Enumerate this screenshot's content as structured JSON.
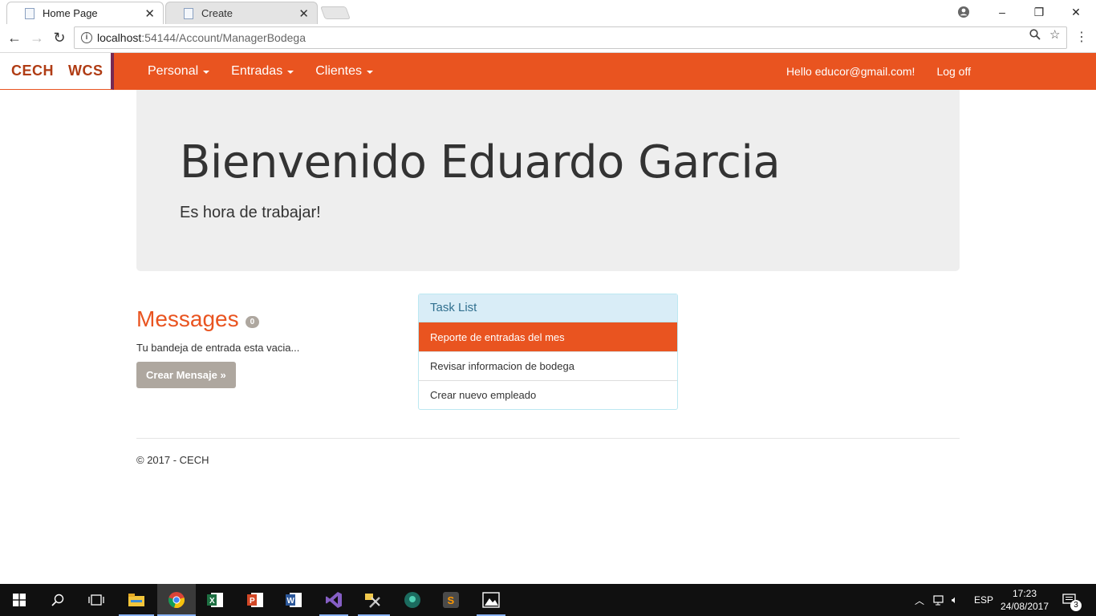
{
  "browser": {
    "tabs": [
      {
        "label": "Home Page",
        "active": true
      },
      {
        "label": "Create",
        "active": false
      }
    ],
    "url_host": "localhost",
    "url_path": ":54144/Account/ManagerBodega",
    "window_controls": {
      "minimize": "–",
      "maximize": "❐",
      "close": "✕"
    }
  },
  "navbar": {
    "brand_left": "CECH",
    "brand_right": "WCS",
    "menu": [
      {
        "label": "Personal"
      },
      {
        "label": "Entradas"
      },
      {
        "label": "Clientes"
      }
    ],
    "greeting": "Hello educor@gmail.com!",
    "logoff": "Log off",
    "accent_color": "#e95420"
  },
  "jumbotron": {
    "title": "Bienvenido Eduardo Garcia",
    "subtitle": "Es hora de trabajar!"
  },
  "messages": {
    "title": "Messages",
    "count": "0",
    "empty_text": "Tu bandeja de entrada esta vacia...",
    "button": "Crear Mensaje »"
  },
  "tasklist": {
    "title": "Task List",
    "items": [
      {
        "label": "Reporte de entradas del mes"
      },
      {
        "label": "Revisar informacion de bodega"
      },
      {
        "label": "Crear nuevo empleado"
      }
    ]
  },
  "footer": {
    "text": "© 2017 - CECH"
  },
  "taskbar": {
    "language": "ESP",
    "time": "17:23",
    "date": "24/08/2017",
    "notifications": "3"
  }
}
